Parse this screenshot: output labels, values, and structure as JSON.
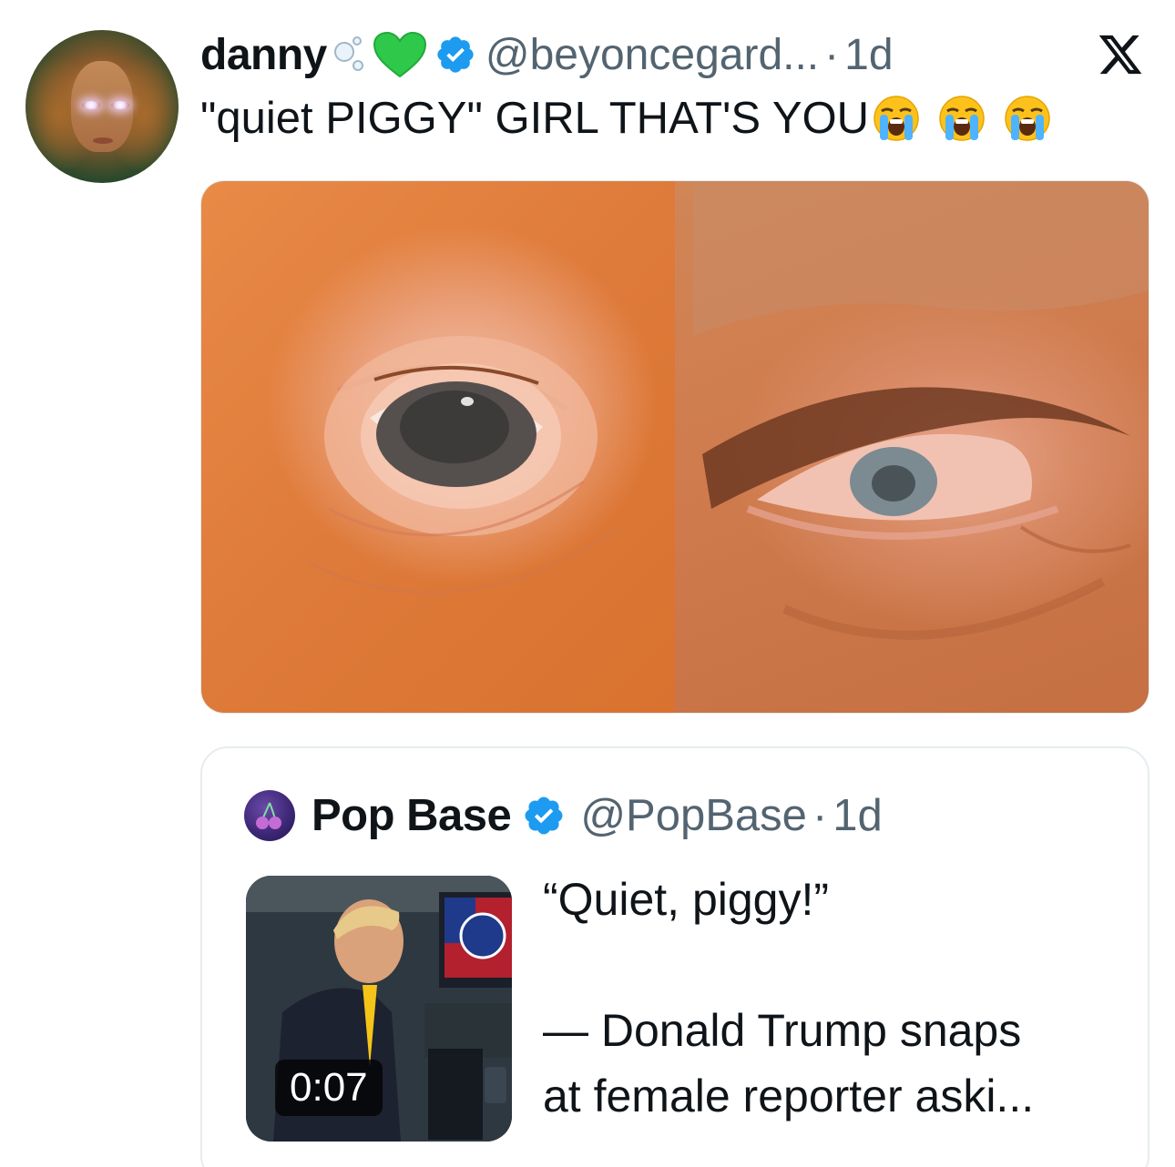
{
  "tweet": {
    "author_name": "danny",
    "handle": "@beyoncegard...",
    "separator": "·",
    "time": "1d",
    "text": "\"quiet PIGGY\" GIRL THAT'S YOU",
    "emojis": [
      "loudly-crying-face",
      "loudly-crying-face",
      "loudly-crying-face"
    ],
    "name_decorations": [
      "bubbles",
      "green-heart",
      "verified-badge"
    ]
  },
  "quoted_tweet": {
    "author_name": "Pop Base",
    "handle": "@PopBase",
    "separator": "·",
    "time": "1d",
    "text_line1": "“Quiet, piggy!”",
    "text_line2": "— Donald Trump snaps",
    "text_line3": "at female reporter aski...",
    "video_duration": "0:07"
  },
  "icons": {
    "x_logo": "x-logo-icon",
    "verified": "verified-badge-icon"
  },
  "colors": {
    "verified_blue": "#1d9bf0",
    "handle_gray": "#536471",
    "text": "#0f1419",
    "green_heart": "#2ec94b"
  }
}
